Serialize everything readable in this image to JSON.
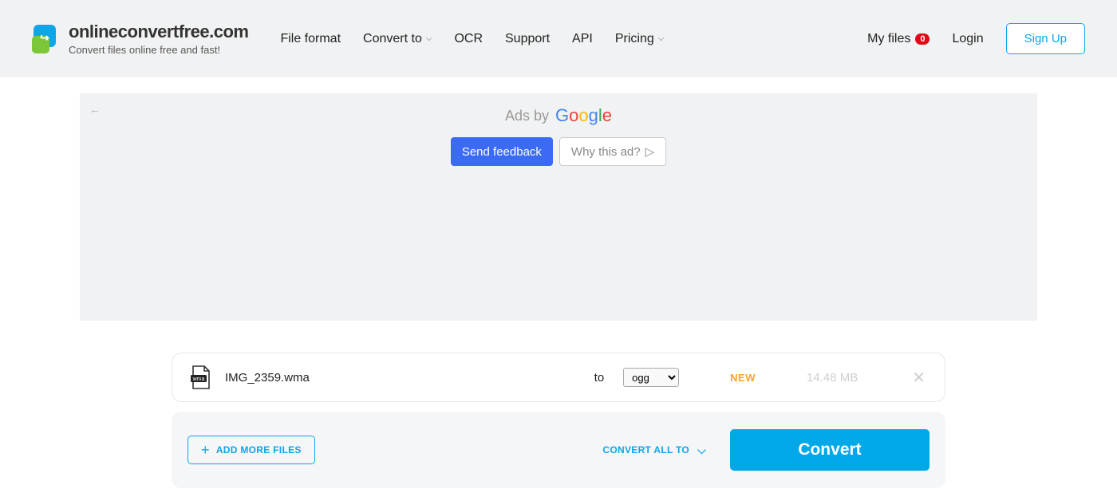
{
  "logo": {
    "title": "onlineconvertfree.com",
    "subtitle": "Convert files online free and fast!"
  },
  "nav": {
    "file_format": "File format",
    "convert_to": "Convert to",
    "ocr": "OCR",
    "support": "Support",
    "api": "API",
    "pricing": "Pricing"
  },
  "right": {
    "my_files": "My files",
    "my_files_count": "0",
    "login": "Login",
    "signup": "Sign Up"
  },
  "ad": {
    "ads_by": "Ads by",
    "send_feedback": "Send feedback",
    "why_this_ad": "Why this ad?"
  },
  "file": {
    "name": "IMG_2359.wma",
    "ext_label": "wma",
    "to": "to",
    "format": "ogg",
    "new_tag": "NEW",
    "size": "14.48 MB"
  },
  "actions": {
    "add_more": "ADD MORE FILES",
    "convert_all": "CONVERT ALL TO",
    "convert": "Convert"
  }
}
